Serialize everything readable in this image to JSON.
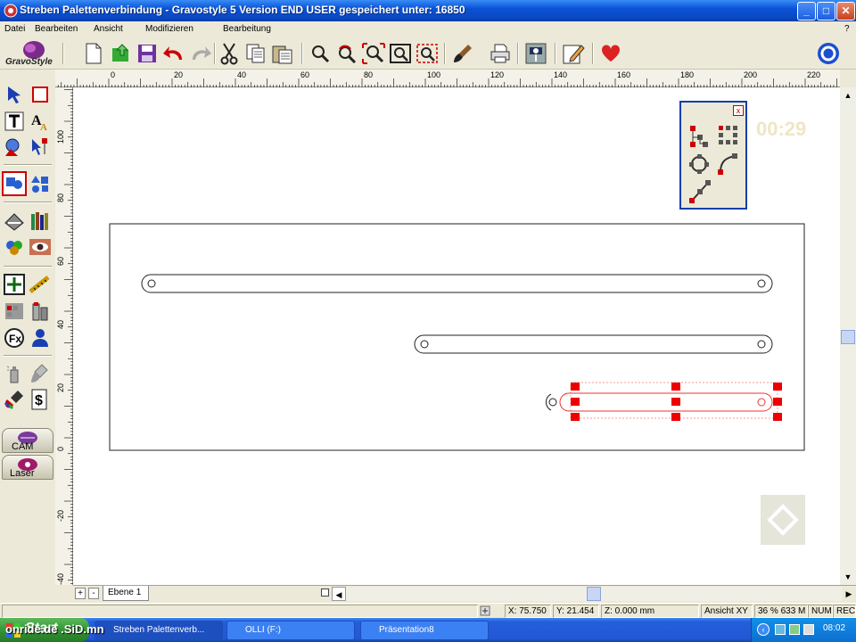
{
  "window": {
    "title": "Streben Palettenverbindung - Gravostyle 5  Version END USER gespeichert unter: 16850",
    "buttons": {
      "minimize": "_",
      "maximize": "□",
      "close": "✕"
    }
  },
  "menu": {
    "items": [
      "Datei",
      "Bearbeiten",
      "Ansicht",
      "Modifizieren",
      "Bearbeitung"
    ],
    "help": "?"
  },
  "brand": {
    "logo_text": "GravoStyle",
    "accent": "#7a2a8a"
  },
  "toolbar": {
    "buttons": [
      "new-document",
      "open-file",
      "save",
      "undo",
      "redo",
      "cut",
      "copy",
      "paste",
      "zoom",
      "zoom-refresh",
      "zoom-fit",
      "zoom-window",
      "zoom-selection",
      "brush",
      "print",
      "engraving-machine",
      "edit-pencil",
      "favorite-heart"
    ]
  },
  "toolbox": {
    "tools": [
      "select-arrow",
      "rectangle",
      "text",
      "text-attributes",
      "shapes",
      "node-edit",
      "group",
      "align",
      "scanner",
      "library",
      "colors",
      "view-eye",
      "move",
      "measure",
      "fill",
      "paint",
      "fx",
      "user",
      "spray",
      "brush-tool",
      "paint-bucket",
      "cost-calculator"
    ],
    "modes": {
      "cam": "CAM",
      "laser": "Laser"
    }
  },
  "ruler_top": {
    "labels": [
      "0",
      "20",
      "40",
      "60",
      "80",
      "100",
      "120",
      "140",
      "160",
      "180",
      "200",
      "220"
    ]
  },
  "ruler_left": {
    "labels": [
      "100",
      "80",
      "60",
      "40",
      "20",
      "0",
      "-20",
      "-40"
    ]
  },
  "palette": {
    "close": "x",
    "tools": [
      "node-tree",
      "node-grid",
      "node-circle",
      "node-curve",
      "node-line"
    ]
  },
  "timer": "00:29",
  "layer": {
    "name": "Ebene 1",
    "add": "+",
    "remove": "-"
  },
  "status": {
    "x": "X: 75.750",
    "y": "Y: 21.454",
    "z": "Z: 0.000 mm",
    "view": "Ansicht XY",
    "zoom_mem": "36 % 633 M",
    "num": "NUM",
    "rec": "REC"
  },
  "taskbar": {
    "start": "Start",
    "watermark": "onride.de .SiD.mn",
    "tasks": [
      {
        "label": "Streben Palettenverb...",
        "active": true
      },
      {
        "label": "OLLI (F:)",
        "active": false
      },
      {
        "label": "Präsentation8",
        "active": false
      }
    ],
    "clock": "08:02"
  }
}
